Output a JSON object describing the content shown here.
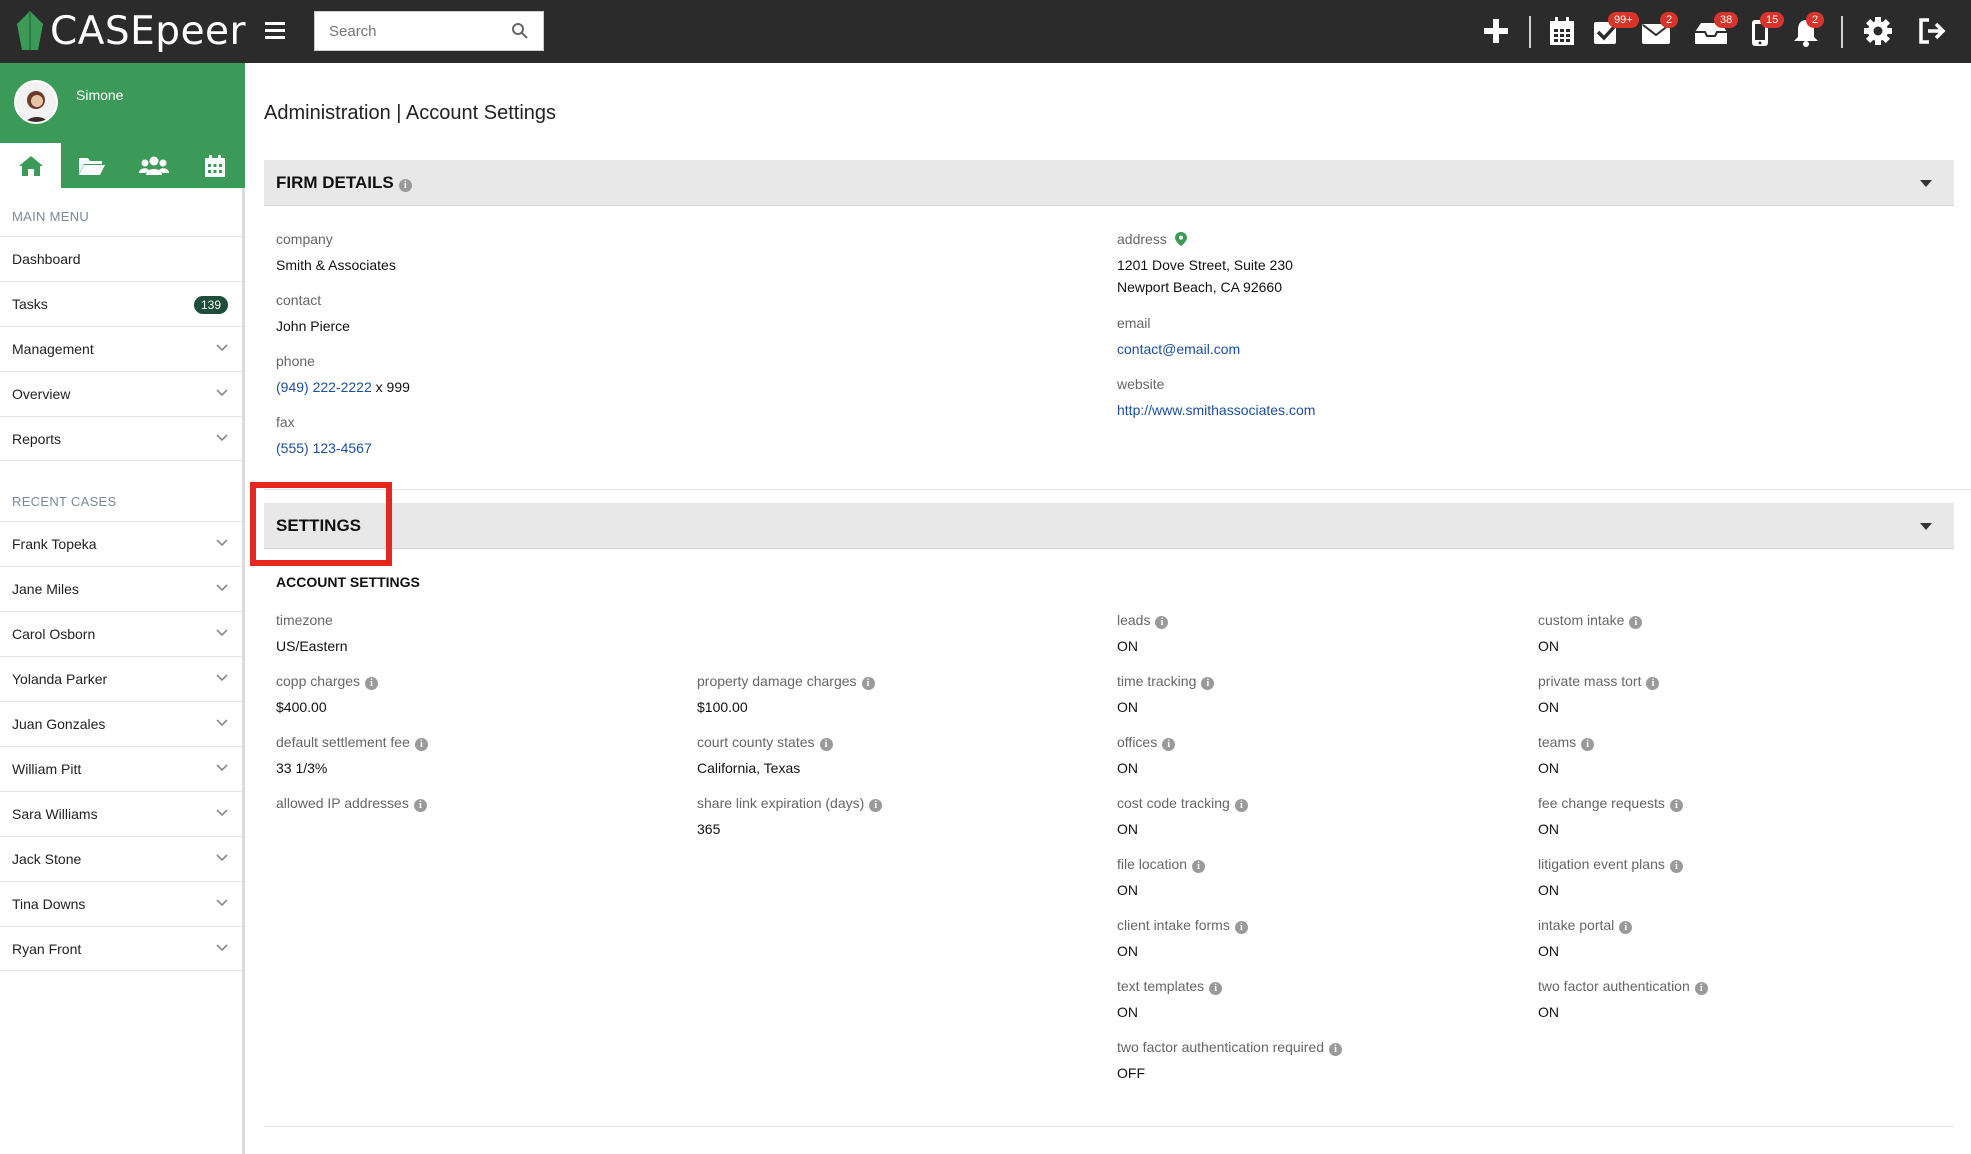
{
  "app": {
    "brand": "CASEpeer",
    "search_placeholder": "Search",
    "badges": {
      "tasks": "99+",
      "messages": "2",
      "inbox": "38",
      "texts": "15",
      "notifications": "2"
    },
    "colors": {
      "brand_green": "#3c9a59",
      "topbar": "#2b2b2b",
      "badge_red": "#d9342b",
      "link_blue": "#1d4f9c",
      "highlight_red": "#e8271b"
    }
  },
  "sidebar": {
    "user_name": "Simone",
    "main_menu_label": "MAIN MENU",
    "main_menu": [
      {
        "label": "Dashboard"
      },
      {
        "label": "Tasks",
        "count": "139"
      },
      {
        "label": "Management"
      },
      {
        "label": "Overview"
      },
      {
        "label": "Reports"
      }
    ],
    "recent_cases_label": "RECENT CASES",
    "recent_cases": [
      {
        "label": "Frank Topeka"
      },
      {
        "label": "Jane Miles"
      },
      {
        "label": "Carol Osborn"
      },
      {
        "label": "Yolanda Parker"
      },
      {
        "label": "Juan Gonzales"
      },
      {
        "label": "William Pitt"
      },
      {
        "label": "Sara Williams"
      },
      {
        "label": "Jack Stone"
      },
      {
        "label": "Tina Downs"
      },
      {
        "label": "Ryan Front"
      }
    ]
  },
  "page": {
    "title": "Administration | Account Settings"
  },
  "firm_details": {
    "title": "FIRM DETAILS",
    "company_label": "company",
    "company": "Smith & Associates",
    "contact_label": "contact",
    "contact": "John Pierce",
    "phone_label": "phone",
    "phone": "(949) 222-2222",
    "phone_ext": "x 999",
    "fax_label": "fax",
    "fax": "(555) 123-4567",
    "address_label": "address",
    "address_line1": "1201 Dove Street, Suite 230",
    "address_line2": "Newport Beach, CA 92660",
    "email_label": "email",
    "email": "contact@email.com",
    "website_label": "website",
    "website": "http://www.smithassociates.com"
  },
  "settings": {
    "title": "SETTINGS",
    "account_settings_title": "ACCOUNT SETTINGS",
    "timezone_label": "timezone",
    "timezone": "US/Eastern",
    "copp_label": "copp charges",
    "copp": "$400.00",
    "settlement_fee_label": "default settlement fee",
    "settlement_fee": "33 1/3%",
    "allowed_ip_label": "allowed IP addresses",
    "property_damage_label": "property damage charges",
    "property_damage": "$100.00",
    "court_county_label": "court county states",
    "court_county": "California, Texas",
    "share_link_label": "share link expiration (days)",
    "share_link": "365",
    "leads_label": "leads",
    "leads": "ON",
    "time_tracking_label": "time tracking",
    "time_tracking": "ON",
    "offices_label": "offices",
    "offices": "ON",
    "cost_code_label": "cost code tracking",
    "cost_code": "ON",
    "file_location_label": "file location",
    "file_location": "ON",
    "client_intake_label": "client intake forms",
    "client_intake": "ON",
    "text_templates_label": "text templates",
    "text_templates": "ON",
    "tfa_required_label": "two factor authentication required",
    "tfa_required": "OFF",
    "custom_intake_label": "custom intake",
    "custom_intake": "ON",
    "private_mass_tort_label": "private mass tort",
    "private_mass_tort": "ON",
    "teams_label": "teams",
    "teams": "ON",
    "fee_change_label": "fee change requests",
    "fee_change": "ON",
    "litigation_label": "litigation event plans",
    "litigation": "ON",
    "intake_portal_label": "intake portal",
    "intake_portal": "ON",
    "tfa_label": "two factor authentication",
    "tfa": "ON"
  },
  "icons": [
    "logo-leaf-icon",
    "hamburger-icon",
    "search-icon",
    "plus-icon",
    "calendar-icon",
    "tasks-check-icon",
    "mail-icon",
    "inbox-icon",
    "phone-icon",
    "bell-icon",
    "gear-icon",
    "logout-icon",
    "home-icon",
    "folder-icon",
    "users-icon",
    "info-icon",
    "map-pin-icon",
    "chevron-down-icon",
    "caret-down-icon"
  ]
}
